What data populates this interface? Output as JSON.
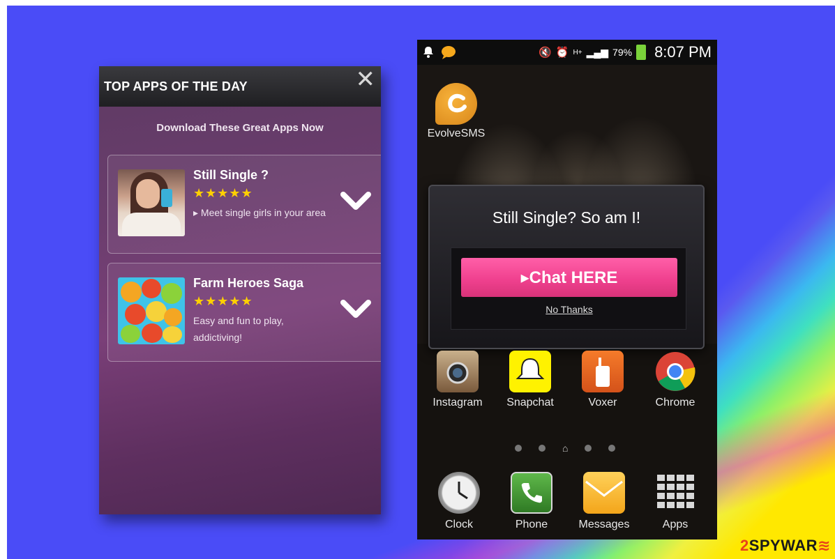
{
  "left_panel": {
    "title": "TOP APPS OF THE DAY",
    "close": "✕",
    "subtitle": "Download These Great Apps Now",
    "apps": [
      {
        "name": "Still Single ?",
        "stars": "★★★★★",
        "desc": "▸ Meet single girls in your area"
      },
      {
        "name": "Farm Heroes Saga",
        "stars": "★★★★★",
        "desc": "Easy and fun to play, addictiving!"
      }
    ]
  },
  "right_panel": {
    "status": {
      "battery": "79%",
      "time": "8:07 PM"
    },
    "top_app_label": "EvolveSMS",
    "popup": {
      "title": "Still Single? So am I!",
      "chat_button": "▸Chat HERE",
      "no_thanks": "No Thanks"
    },
    "row_apps": [
      "Instagram",
      "Snapchat",
      "Voxer",
      "Chrome"
    ],
    "dock_apps": [
      "Clock",
      "Phone",
      "Messages",
      "Apps"
    ]
  },
  "watermark": {
    "prefix": "2",
    "brand": "SPYWAR",
    "suffix": "≋"
  },
  "colors": {
    "background": "#4a4cf7",
    "chat_button": "#f0418f",
    "stars": "#ffd000",
    "left_panel": "#6a3d6d"
  }
}
